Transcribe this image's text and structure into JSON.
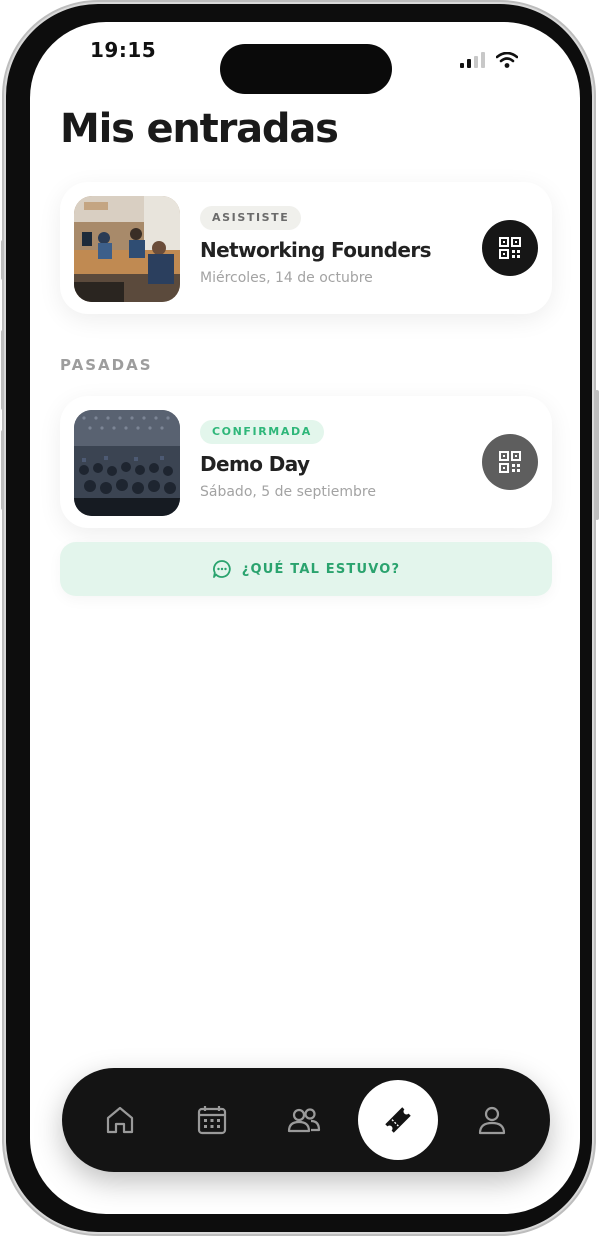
{
  "status_bar": {
    "time": "19:15"
  },
  "page": {
    "title": "Mis entradas"
  },
  "events": [
    {
      "badge": "ASISTISTE",
      "title": "Networking Founders",
      "date": "Miércoles, 14 de octubre"
    },
    {
      "badge": "CONFIRMADA",
      "title": "Demo Day",
      "date": "Sábado, 5 de septiembre"
    }
  ],
  "sections": {
    "past_label": "PASADAS"
  },
  "feedback": {
    "label": "¿QUÉ TAL ESTUVO?"
  },
  "nav": {
    "items": [
      {
        "icon": "home-icon",
        "active": false
      },
      {
        "icon": "calendar-icon",
        "active": false
      },
      {
        "icon": "people-icon",
        "active": false
      },
      {
        "icon": "ticket-icon",
        "active": true
      },
      {
        "icon": "profile-icon",
        "active": false
      }
    ]
  },
  "colors": {
    "accent_green": "#2aa36e",
    "badge_green_bg": "#e3f6ec",
    "nav_bg": "#141414"
  }
}
